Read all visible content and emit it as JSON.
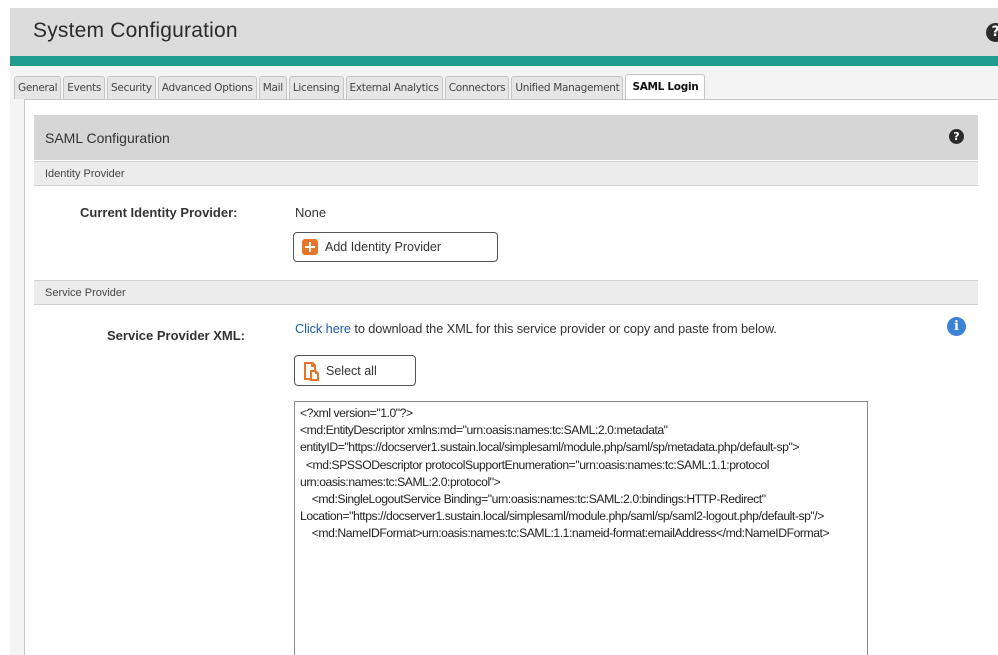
{
  "header": {
    "title": "System Configuration"
  },
  "tabs": [
    {
      "label": "General"
    },
    {
      "label": "Events"
    },
    {
      "label": "Security"
    },
    {
      "label": "Advanced Options"
    },
    {
      "label": "Mail"
    },
    {
      "label": "Licensing"
    },
    {
      "label": "External Analytics"
    },
    {
      "label": "Connectors"
    },
    {
      "label": "Unified Management"
    },
    {
      "label": "SAML Login"
    }
  ],
  "active_tab": "SAML Login",
  "panel": {
    "title": "SAML Configuration"
  },
  "identity_provider": {
    "section_title": "Identity Provider",
    "current_label": "Current Identity Provider:",
    "current_value": "None",
    "add_button": "Add Identity Provider"
  },
  "service_provider": {
    "section_title": "Service Provider",
    "xml_label": "Service Provider XML:",
    "link_text": "Click here",
    "description": " to download the XML for this service provider or copy and paste from below.",
    "select_all_button": "Select all",
    "xml_content": "<?xml version=\"1.0\"?>\n<md:EntityDescriptor xmlns:md=\"urn:oasis:names:tc:SAML:2.0:metadata\" entityID=\"https://docserver1.sustain.local/simplesaml/module.php/saml/sp/metadata.php/default-sp\">\n  <md:SPSSODescriptor protocolSupportEnumeration=\"urn:oasis:names:tc:SAML:1.1:protocol urn:oasis:names:tc:SAML:2.0:protocol\">\n    <md:SingleLogoutService Binding=\"urn:oasis:names:tc:SAML:2.0:bindings:HTTP-Redirect\" Location=\"https://docserver1.sustain.local/simplesaml/module.php/saml/sp/saml2-logout.php/default-sp\"/>\n    <md:NameIDFormat>urn:oasis:names:tc:SAML:1.1:nameid-format:emailAddress</md:NameIDFormat>"
  },
  "colors": {
    "accent": "#1f9c8f",
    "add_icon": "#e8742a",
    "link": "#1a5ea8",
    "info_icon": "#3b82d6"
  }
}
